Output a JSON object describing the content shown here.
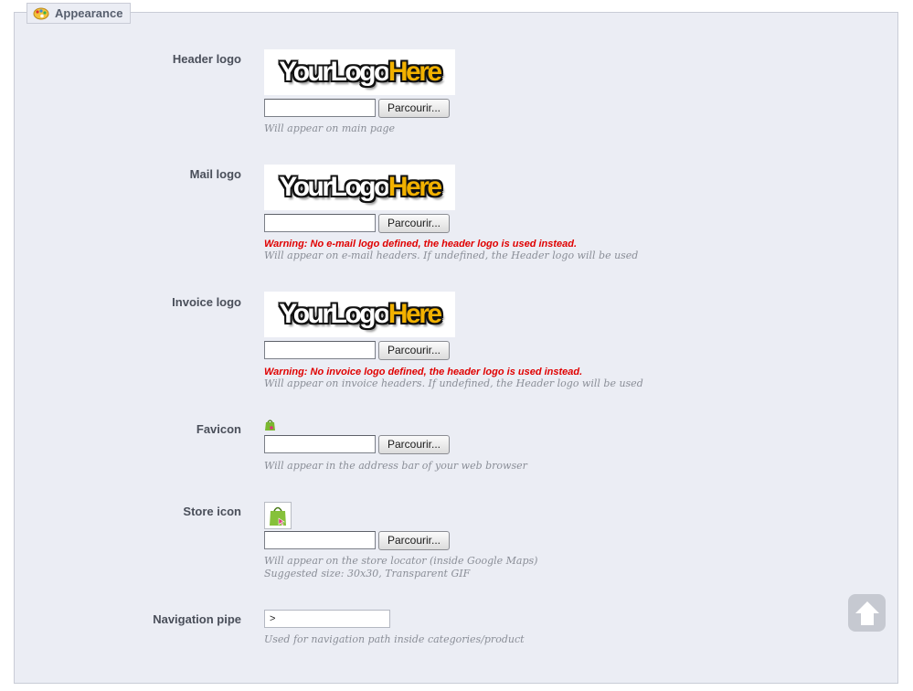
{
  "section": {
    "title": "Appearance",
    "icon": "palette-icon"
  },
  "browse_label": "Parcourir...",
  "logo_text": {
    "part1": "YourLogo",
    "part2": "Here"
  },
  "fields": {
    "header_logo": {
      "label": "Header logo",
      "hint": "Will appear on main page"
    },
    "mail_logo": {
      "label": "Mail logo",
      "warning": "Warning: No e-mail logo defined, the header logo is used instead.",
      "hint": "Will appear on e-mail headers. If undefined, the Header logo will be used"
    },
    "invoice_logo": {
      "label": "Invoice logo",
      "warning": "Warning: No invoice logo defined, the header logo is used instead.",
      "hint": "Will appear on invoice headers. If undefined, the Header logo will be used"
    },
    "favicon": {
      "label": "Favicon",
      "hint": "Will appear in the address bar of your web browser"
    },
    "store_icon": {
      "label": "Store icon",
      "hint1": "Will appear on the store locator (inside Google Maps)",
      "hint2": "Suggested size: 30x30, Transparent GIF"
    },
    "navigation_pipe": {
      "label": "Navigation pipe",
      "value": ">",
      "hint": "Used for navigation path inside categories/product"
    }
  },
  "colors": {
    "accent_warning": "#e00000",
    "logo_gold": "#f2b100",
    "panel_bg": "#ebedf4"
  }
}
